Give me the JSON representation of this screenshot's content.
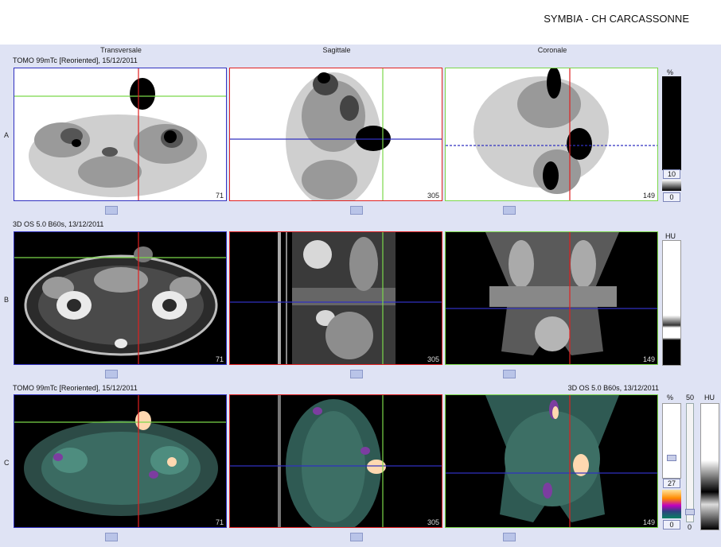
{
  "header": {
    "site": "SYMBIA - CH CARCASSONNE"
  },
  "columns": [
    "Transversale",
    "Sagittale",
    "Coronale"
  ],
  "rows": [
    {
      "letter": "A",
      "title": "TOMO 99mTc [Reoriented], 15/12/2011",
      "title_right": "",
      "slices": [
        "71",
        "305",
        "149"
      ]
    },
    {
      "letter": "B",
      "title": "3D  OS  5.0  B60s, 13/12/2011",
      "title_right": "",
      "slices": [
        "71",
        "305",
        "149"
      ]
    },
    {
      "letter": "C",
      "title": "TOMO 99mTc [Reoriented], 15/12/2011",
      "title_right": "3D  OS  5.0  B60s, 13/12/2011",
      "slices": [
        "71",
        "305",
        "149"
      ]
    }
  ],
  "scale_a": {
    "unit": "%",
    "value": "10",
    "min": "0"
  },
  "scale_b": {
    "unit": "HU"
  },
  "scale_c": {
    "unit": "%",
    "value": "27",
    "min": "0",
    "top": "50",
    "hu": "HU",
    "bottom": "0"
  },
  "colors": {
    "red": "#e02020",
    "green": "#7bd84a",
    "blue": "#3030c0",
    "workspace": "#dfe3f4"
  }
}
